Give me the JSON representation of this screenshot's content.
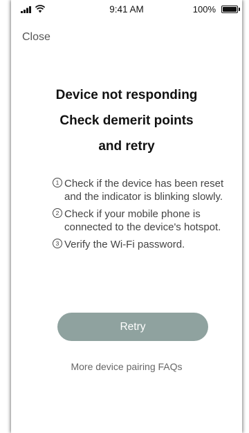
{
  "status_bar": {
    "time": "9:41 AM",
    "battery_percent": "100%",
    "battery_level": 1.0,
    "signal_icon": "signal-bars-icon",
    "wifi_icon": "wifi-icon",
    "battery_icon": "battery-icon"
  },
  "nav": {
    "close_label": "Close"
  },
  "title": {
    "line1": "Device not responding",
    "line2": "Check demerit points",
    "line3": "and retry"
  },
  "steps": [
    {
      "number": "1",
      "text": "Check if the device has been reset and the indicator is blinking slowly."
    },
    {
      "number": "2",
      "text": "Check if your mobile phone is connected to the device's hotspot."
    },
    {
      "number": "3",
      "text": "Verify the Wi-Fi password."
    }
  ],
  "retry_button": {
    "label": "Retry",
    "color": "#8fa29f"
  },
  "faq_link": {
    "label": "More device pairing FAQs"
  }
}
